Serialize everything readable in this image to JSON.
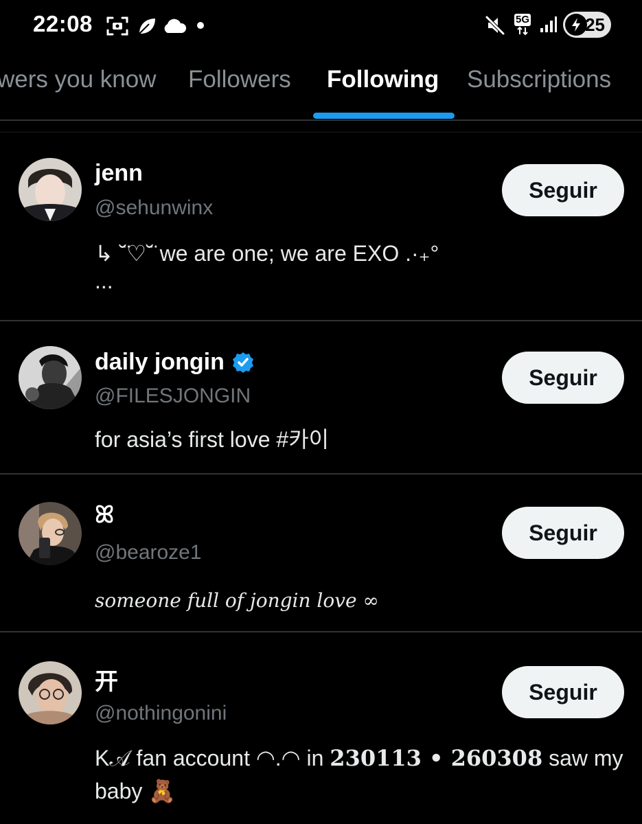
{
  "status_bar": {
    "time": "22:08",
    "network": "5G",
    "battery": "25",
    "icons": [
      "screenshot-icon",
      "leaf-icon",
      "cloud-icon",
      "dot-icon",
      "mute-icon",
      "network-5g-icon",
      "signal-icon",
      "battery-charging-icon"
    ]
  },
  "tabs": [
    {
      "label": "wers you know",
      "active": false
    },
    {
      "label": "Followers",
      "active": false
    },
    {
      "label": "Following",
      "active": true
    },
    {
      "label": "Subscriptions",
      "active": false
    }
  ],
  "accent_color": "#1d9bf0",
  "users": [
    {
      "name": "jenn",
      "handle": "@sehunwinx",
      "bio_line1": "↳ ˘̈♡˘̈ we are one; we are EXO .·₊°",
      "bio_line2": "...",
      "verified": false,
      "button": "Seguir"
    },
    {
      "name": "daily jongin",
      "handle": "@FILESJONGIN",
      "bio_line1": "for asia’s first love #카이",
      "verified": true,
      "button": "Seguir"
    },
    {
      "name": "ꕤ",
      "handle": "@bearoze1",
      "bio_line1": "someone full of jongin love ∞",
      "verified": false,
      "button": "Seguir"
    },
    {
      "name": "开",
      "handle": "@nothingonini",
      "bio_prefix": "K𝒜 fan account ◠.◠ in ",
      "bio_dates": "230113 • 260308",
      "bio_suffix": " saw my",
      "bio_line2": "baby 🧸",
      "verified": false,
      "button": "Seguir"
    }
  ]
}
